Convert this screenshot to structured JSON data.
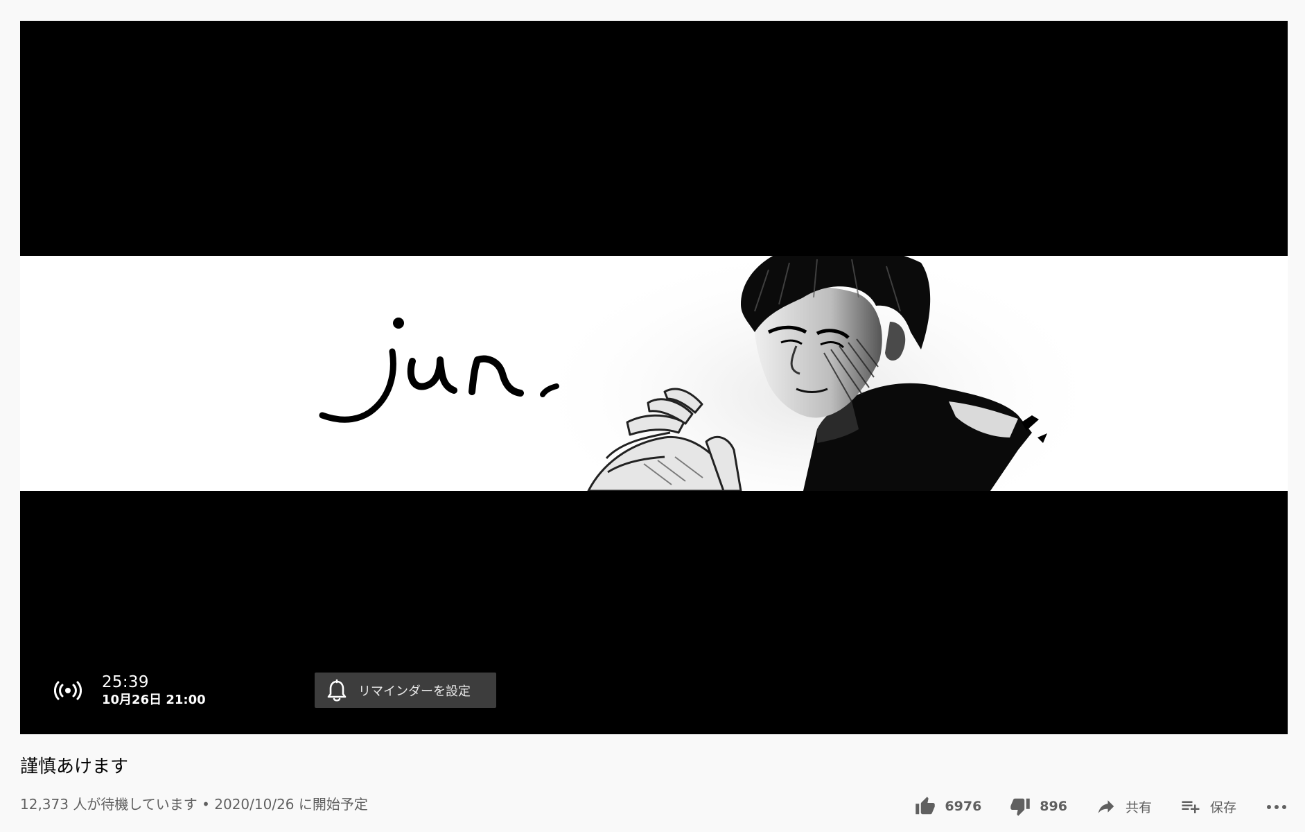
{
  "video": {
    "banner_logo_text": "jun.",
    "countdown_time": "25:39",
    "scheduled_datetime": "10月26日 21:00",
    "reminder_label": "リマインダーを設定"
  },
  "info": {
    "title": "謹慎あけます",
    "waiting_text": "12,373 人が待機しています • 2020/10/26 に開始予定"
  },
  "actions": {
    "like_count": "6976",
    "dislike_count": "896",
    "share_label": "共有",
    "save_label": "保存"
  },
  "colors": {
    "page_background": "#f9f9f9",
    "player_background": "#000000",
    "reminder_button": "#3d3d3d",
    "secondary_text": "#606060"
  },
  "icons": {
    "live": "live-broadcast-icon",
    "bell": "bell-icon",
    "like": "thumbs-up-icon",
    "dislike": "thumbs-down-icon",
    "share": "share-arrow-icon",
    "save": "playlist-add-icon",
    "more": "more-horizontal-icon"
  }
}
